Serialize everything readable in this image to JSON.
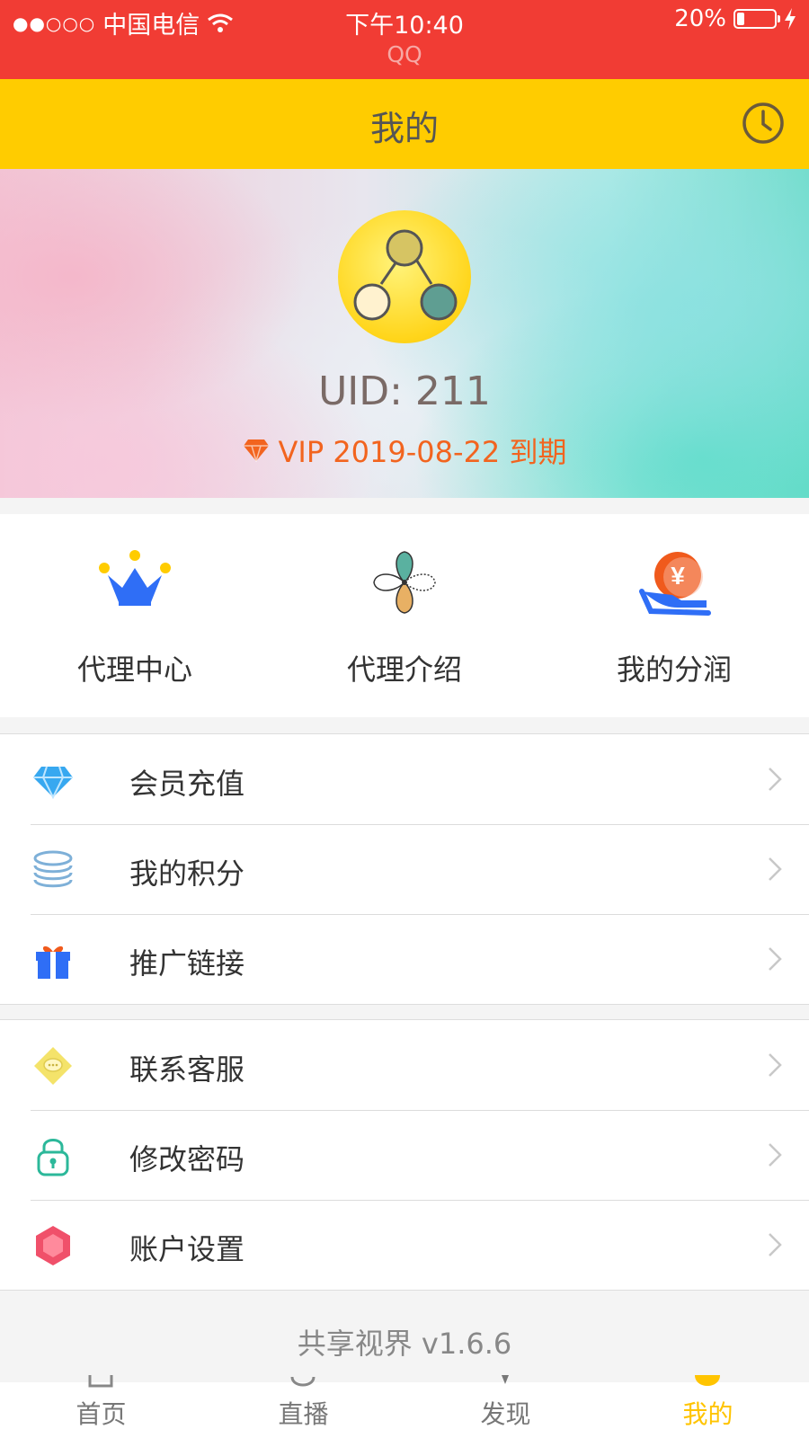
{
  "status_bar": {
    "signal": "●●○○○",
    "carrier": "中国电信",
    "time": "下午10:40",
    "battery_percent": "20%",
    "battery_level": 0.2,
    "sub_label": "QQ"
  },
  "nav": {
    "title": "我的",
    "right_icon": "clock-icon"
  },
  "profile": {
    "avatar_icon": "share-nodes-icon",
    "uid": "UID: 211",
    "vip_text": "VIP 2019-08-22 到期",
    "vip_icon": "diamond-icon"
  },
  "agent_items": [
    {
      "label": "代理中心",
      "icon": "crown-icon"
    },
    {
      "label": "代理介绍",
      "icon": "clover-icon"
    },
    {
      "label": "我的分润",
      "icon": "yen-hand-icon"
    }
  ],
  "menu_group_1": [
    {
      "label": "会员充值",
      "icon": "diamond-icon"
    },
    {
      "label": "我的积分",
      "icon": "coins-icon"
    },
    {
      "label": "推广链接",
      "icon": "gift-icon"
    }
  ],
  "menu_group_2": [
    {
      "label": "联系客服",
      "icon": "chat-icon"
    },
    {
      "label": "修改密码",
      "icon": "lock-icon"
    },
    {
      "label": "账户设置",
      "icon": "hexagon-icon"
    }
  ],
  "version": "共享视界 v1.6.6",
  "tabs": [
    {
      "label": "首页",
      "active": false
    },
    {
      "label": "直播",
      "active": false
    },
    {
      "label": "发现",
      "active": false
    },
    {
      "label": "我的",
      "active": true
    }
  ],
  "colors": {
    "status_bar": "#f13c34",
    "nav_bar": "#ffcc00",
    "vip_orange": "#f2641f",
    "tab_active": "#ffc400"
  }
}
